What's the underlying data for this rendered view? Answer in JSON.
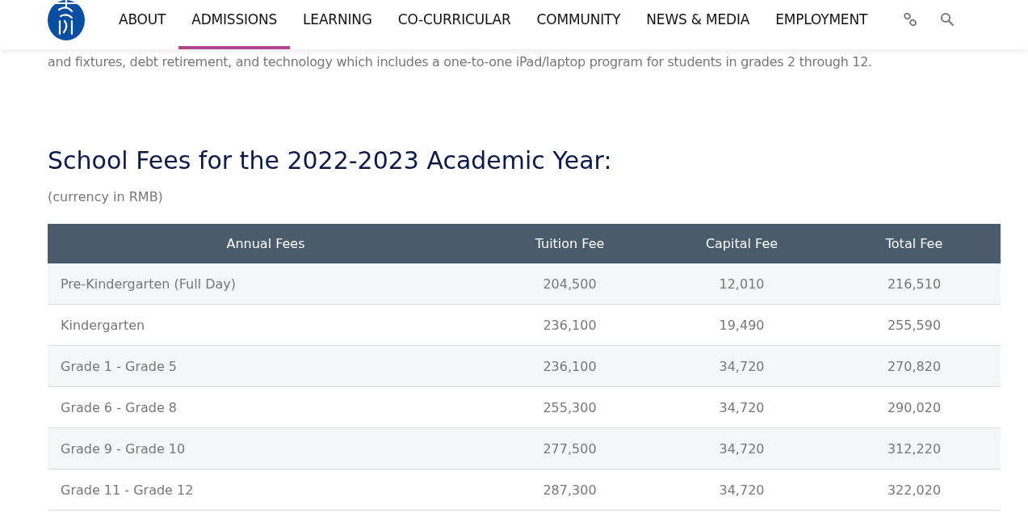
{
  "nav": {
    "items": [
      {
        "label": "ABOUT",
        "selected": false
      },
      {
        "label": "ADMISSIONS",
        "selected": true
      },
      {
        "label": "LEARNING",
        "selected": false
      },
      {
        "label": "CO-CURRICULAR",
        "selected": false
      },
      {
        "label": "COMMUNITY",
        "selected": false
      },
      {
        "label": "NEWS & MEDIA",
        "selected": false
      },
      {
        "label": "EMPLOYMENT",
        "selected": false
      }
    ]
  },
  "intro_text": "and fixtures, debt retirement, and technology which includes a one-to-one iPad/laptop program for students in grades 2 through 12.",
  "heading": "School Fees for the 2022-2023 Academic Year:",
  "currency_note": "(currency in RMB)",
  "table": {
    "columns": [
      "Annual Fees",
      "Tuition Fee",
      "Capital Fee",
      "Total Fee"
    ],
    "rows": [
      [
        "Pre-Kindergarten (Full Day)",
        "204,500",
        "12,010",
        "216,510"
      ],
      [
        "Kindergarten",
        "236,100",
        "19,490",
        "255,590"
      ],
      [
        "Grade 1 - Grade 5",
        "236,100",
        "34,720",
        "270,820"
      ],
      [
        "Grade 6 - Grade 8",
        "255,300",
        "34,720",
        "290,020"
      ],
      [
        "Grade 9 - Grade 10",
        "277,500",
        "34,720",
        "312,220"
      ],
      [
        "Grade 11 - Grade 12",
        "287,300",
        "34,720",
        "322,020"
      ]
    ]
  }
}
